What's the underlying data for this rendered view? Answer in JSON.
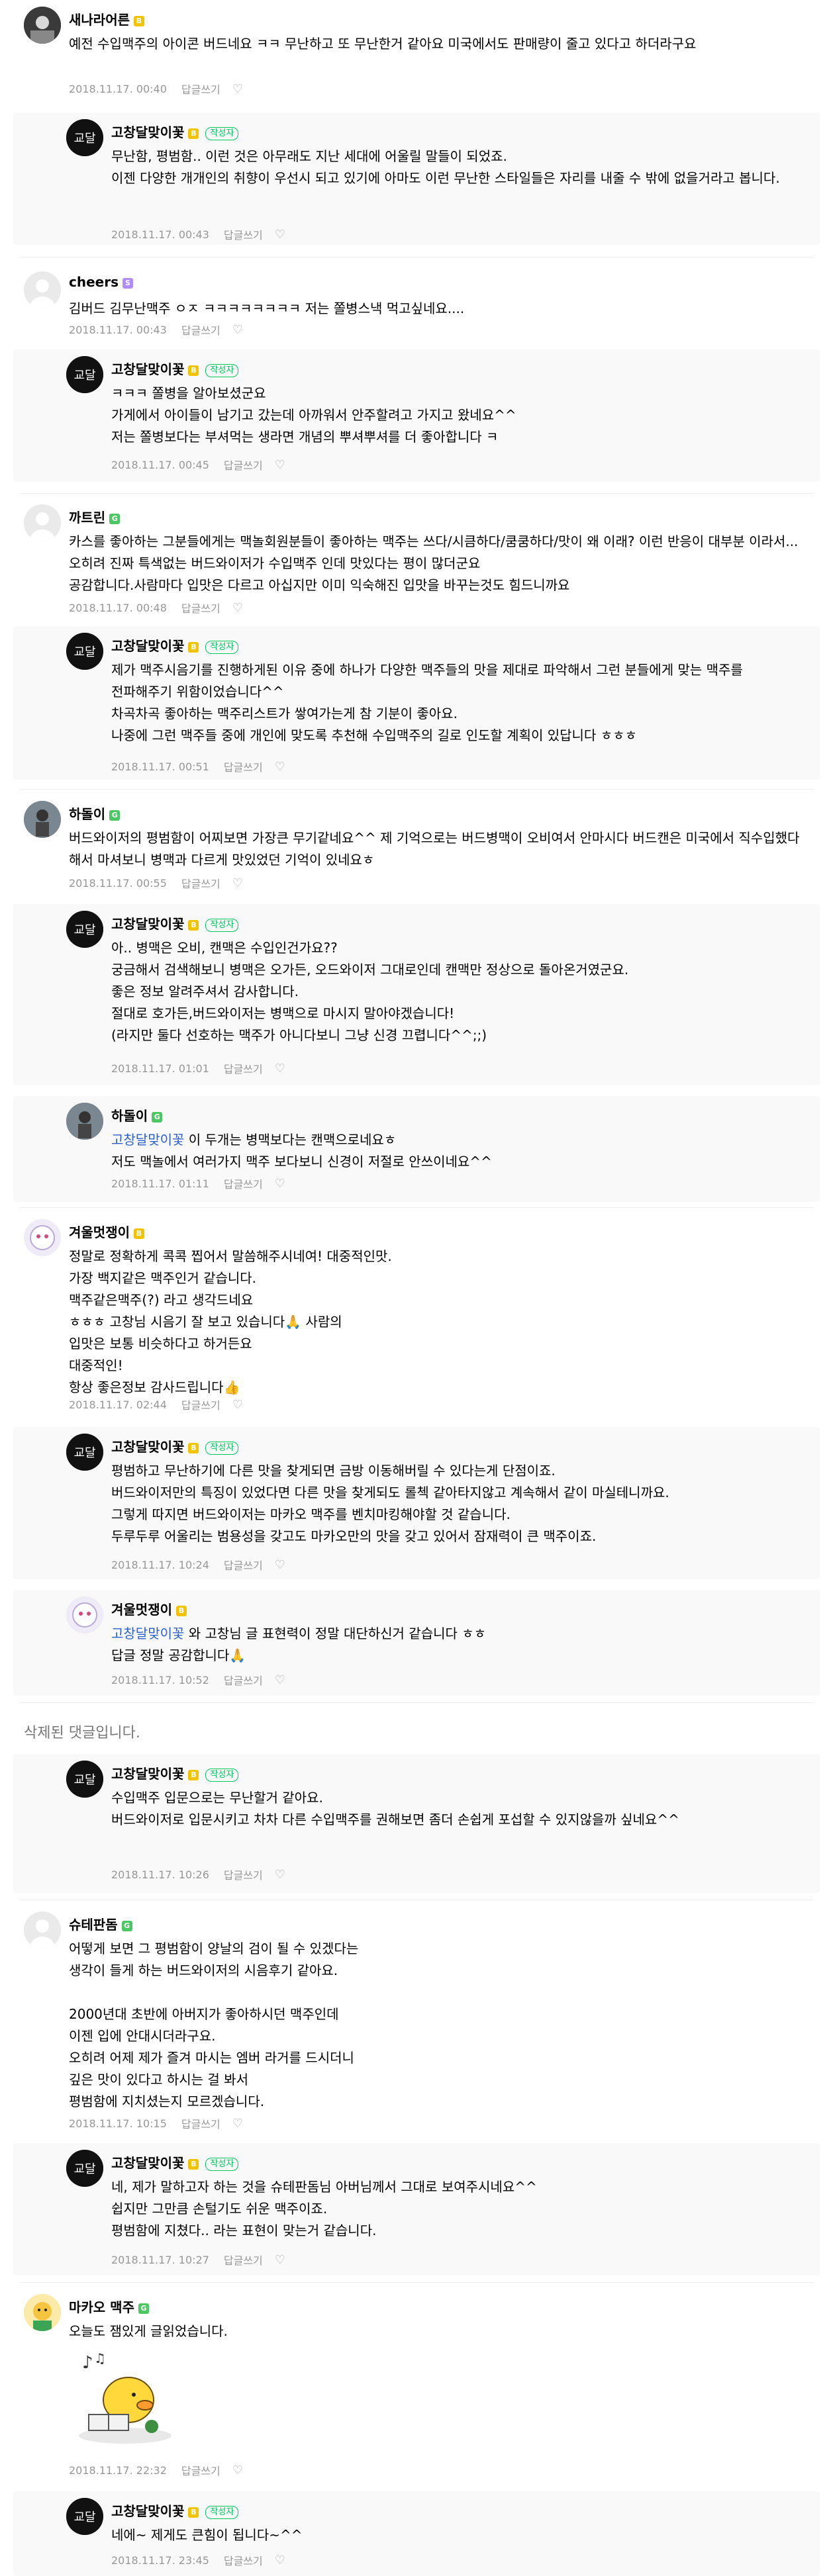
{
  "comments": [
    {
      "nickname": "새나라어른",
      "text": "예전 수입맥주의 아이콘 버드네요 ㅋㅋ 무난하고 또 무난한거 같아요 미국에서도 판매량이 줄고 있다고 하더라구요",
      "date": "2018.11.17. 00:40",
      "reply_label": "답글쓰기"
    },
    {
      "nickname": "고창달맞이꽃",
      "author_tag": "작성자",
      "text": "무난함, 평범함.. 이런 것은 아무래도 지난 세대에 어울릴 말들이 되었죠.\n이젠 다양한 개개인의 취향이 우선시 되고 있기에 아마도 이런 무난한 스타일들은 자리를 내줄 수 밖에 없을거라고 봅니다.",
      "date": "2018.11.17. 00:43",
      "reply_label": "답글쓰기"
    },
    {
      "nickname": "cheers",
      "text": "김버드 김무난맥주 ㅇㅈ ㅋㅋㅋㅋㅋㅋㅋㅋ 저는 쫄병스낵 먹고싶네요....",
      "date": "2018.11.17. 00:43",
      "reply_label": "답글쓰기"
    },
    {
      "nickname": "고창달맞이꽃",
      "author_tag": "작성자",
      "text": "ㅋㅋㅋ 쫄병을 알아보셨군요\n가게에서 아이들이 남기고 갔는데 아까워서 안주할려고 가지고 왔네요^^\n저는 쫄병보다는 부셔먹는 생라면 개념의 뿌셔뿌셔를 더 좋아합니다 ㅋ",
      "date": "2018.11.17. 00:45",
      "reply_label": "답글쓰기"
    },
    {
      "nickname": "까트린",
      "text": "카스를 좋아하는 그분들에게는 맥놀회원분들이 좋아하는 맥주는 쓰다/시큼하다/쿰쿰하다/맛이 왜 이래? 이런 반응이 대부분 이라서...오히려 진짜 특색없는 버드와이저가 수입맥주 인데 맛있다는 평이 많더군요\n공감합니다.사람마다 입맛은 다르고 아십지만 이미 익숙해진 입맛을 바꾸는것도 힘드니까요",
      "date": "2018.11.17. 00:48",
      "reply_label": "답글쓰기"
    },
    {
      "nickname": "고창달맞이꽃",
      "author_tag": "작성자",
      "text": "제가 맥주시음기를 진행하게된 이유 중에 하나가 다양한 맥주들의 맛을 제대로 파악해서 그런 분들에게 맞는 맥주를 전파해주기 위함이었습니다^^\n차곡차곡 좋아하는 맥주리스트가 쌓여가는게 참 기분이 좋아요.\n나중에 그런 맥주들 중에 개인에 맞도록 추천해 수입맥주의 길로 인도할 계획이 있답니다 ㅎㅎㅎ",
      "date": "2018.11.17. 00:51",
      "reply_label": "답글쓰기"
    },
    {
      "nickname": "하돌이",
      "text": "버드와이저의 평범함이 어찌보면 가장큰 무기같네요^^ 제 기억으로는 버드병맥이 오비여서 안마시다 버드캔은 미국에서 직수입했다 해서 마셔보니 병맥과 다르게 맛있었던 기억이 있네요ㅎ",
      "date": "2018.11.17. 00:55",
      "reply_label": "답글쓰기"
    },
    {
      "nickname": "고창달맞이꽃",
      "author_tag": "작성자",
      "text": "아.. 병맥은 오비, 캔맥은 수입인건가요??\n궁금해서 검색해보니 병맥은 오가든, 오드와이저 그대로인데 캔맥만 정상으로 돌아온거였군요.\n좋은 정보 알려주셔서 감사합니다.\n절대로 호가든,버드와이저는 병맥으로 마시지 말아야겠습니다!\n(라지만 둘다 선호하는 맥주가 아니다보니 그냥 신경 끄렵니다^^;;)",
      "date": "2018.11.17. 01:01",
      "reply_label": "답글쓰기"
    },
    {
      "nickname": "하돌이",
      "mention": "고창달맞이꽃",
      "text": " 이 두개는 병맥보다는 캔맥으로네요ㅎ\n저도 맥놀에서 여러가지 맥주 보다보니 신경이 저절로 안쓰이네요^^",
      "date": "2018.11.17. 01:11",
      "reply_label": "답글쓰기"
    },
    {
      "nickname": "겨울멋쟁이",
      "text": "정말로 정확하게 콕콕 찝어서 말씀해주시네여! 대중적인맛.\n가장 백지같은 맥주인거 같습니다.\n맥주같은맥주(?) 라고 생각드네요\nㅎㅎㅎ 고창님 시음기 잘 보고 있습니다🙏 사람의\n입맛은 보통 비슷하다고 하거든요\n대중적인!\n항상 좋은정보 감사드립니다👍",
      "date": "2018.11.17. 02:44",
      "reply_label": "답글쓰기"
    },
    {
      "nickname": "고창달맞이꽃",
      "author_tag": "작성자",
      "text": "평범하고 무난하기에 다른 맛을 찾게되면 금방 이동해버릴 수 있다는게 단점이죠.\n버드와이저만의 특징이 있었다면 다른 맛을 찾게되도 롤첵 같아타지않고 계속해서 같이 마실테니까요.\n그렇게 따지면 버드와이저는 마카오 맥주를 벤치마킹해야할 것 같습니다.\n두루두루 어울리는 범용성을 갖고도 마카오만의 맛을 갖고 있어서 잠재력이 큰 맥주이죠.",
      "date": "2018.11.17. 10:24",
      "reply_label": "답글쓰기"
    },
    {
      "nickname": "겨울멋쟁이",
      "mention": "고창달맞이꽃",
      "text": " 와 고창님 글 표현력이 정말 대단하신거 같습니다 ㅎㅎ\n답글 정말 공감합니다🙏",
      "date": "2018.11.17. 10:52",
      "reply_label": "답글쓰기"
    },
    {
      "deleted_text": "삭제된 댓글입니다."
    },
    {
      "nickname": "고창달맞이꽃",
      "author_tag": "작성자",
      "text": "수입맥주 입문으로는 무난할거 같아요.\n버드와이저로 입문시키고 차차 다른 수입맥주를 권해보면 좀더 손쉽게 포섭할 수 있지않을까 싶네요^^",
      "date": "2018.11.17. 10:26",
      "reply_label": "답글쓰기"
    },
    {
      "nickname": "슈테판돔",
      "text": "어떻게 보면 그 평범함이 양날의 검이 될 수 있겠다는\n생각이 들게 하는 버드와이저의 시음후기 같아요.\n\n2000년대 초반에 아버지가 좋아하시던 맥주인데\n이젠 입에 안대시더라구요.\n오히려 어제 제가 즐겨 마시는 엠버 라거를 드시더니\n깊은 맛이 있다고 하시는 걸 봐서\n평범함에 지치셨는지 모르겠습니다.",
      "date": "2018.11.17. 10:15",
      "reply_label": "답글쓰기"
    },
    {
      "nickname": "고창달맞이꽃",
      "author_tag": "작성자",
      "text": "네, 제가 말하고자 하는 것을 슈테판돔님 아버님께서 그대로 보여주시네요^^\n쉽지만 그만큼 손털기도 쉬운 맥주이죠.\n평범함에 지쳤다.. 라는 표현이 맞는거 같습니다.",
      "date": "2018.11.17. 10:27",
      "reply_label": "답글쓰기"
    },
    {
      "nickname": "마카오 맥주",
      "text": "오늘도 잼있게 글읽었습니다.",
      "date": "2018.11.17. 22:32",
      "reply_label": "답글쓰기"
    },
    {
      "nickname": "고창달맞이꽃",
      "author_tag": "작성자",
      "text": "네에~ 제게도 큰힘이 됩니다~^^",
      "date": "2018.11.17. 23:45",
      "reply_label": "답글쓰기"
    }
  ],
  "colors": {
    "mention": "#2a60c9",
    "author_tag": "#03c75a",
    "meta": "#979797",
    "reply_bg": "#f9f9fa"
  }
}
